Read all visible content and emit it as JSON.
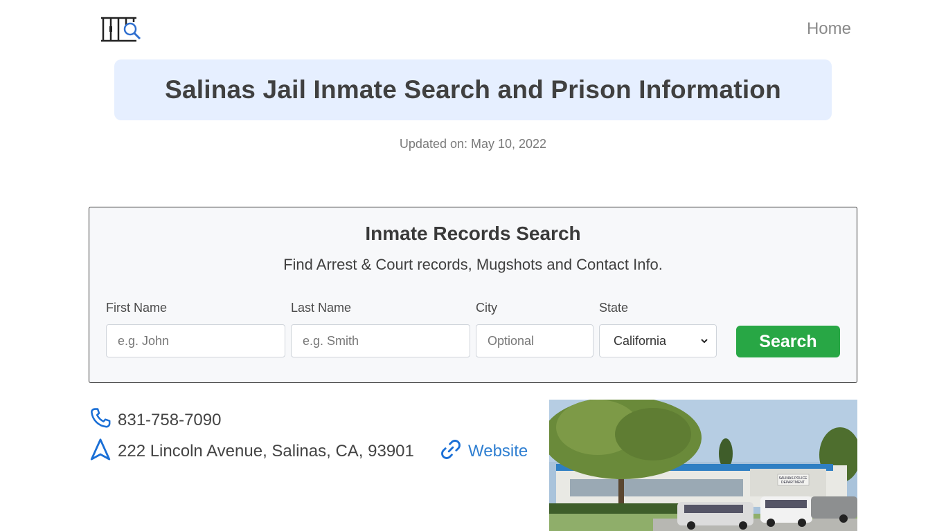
{
  "header": {
    "logo_icon": "jail-search-icon",
    "nav_home": "Home"
  },
  "title": "Salinas Jail Inmate Search and Prison Information",
  "updated": "Updated on: May 10, 2022",
  "search": {
    "title": "Inmate Records Search",
    "subtitle": "Find Arrest & Court records, Mugshots and Contact Info.",
    "first_name_label": "First Name",
    "first_name_placeholder": "e.g. John",
    "last_name_label": "Last Name",
    "last_name_placeholder": "e.g. Smith",
    "city_label": "City",
    "city_placeholder": "Optional",
    "state_label": "State",
    "state_value": "California",
    "button_label": "Search",
    "button_color": "#28a745"
  },
  "contact": {
    "phone_icon": "phone-icon",
    "phone": "831-758-7090",
    "address_icon": "navigation-arrow-icon",
    "address": "222 Lincoln Avenue, Salinas, CA, 93901",
    "website_icon": "link-icon",
    "website_label": "Website",
    "accent": "#1a6fd6"
  },
  "photo": {
    "sign_text": "SALINAS POLICE DEPARTMENT"
  }
}
